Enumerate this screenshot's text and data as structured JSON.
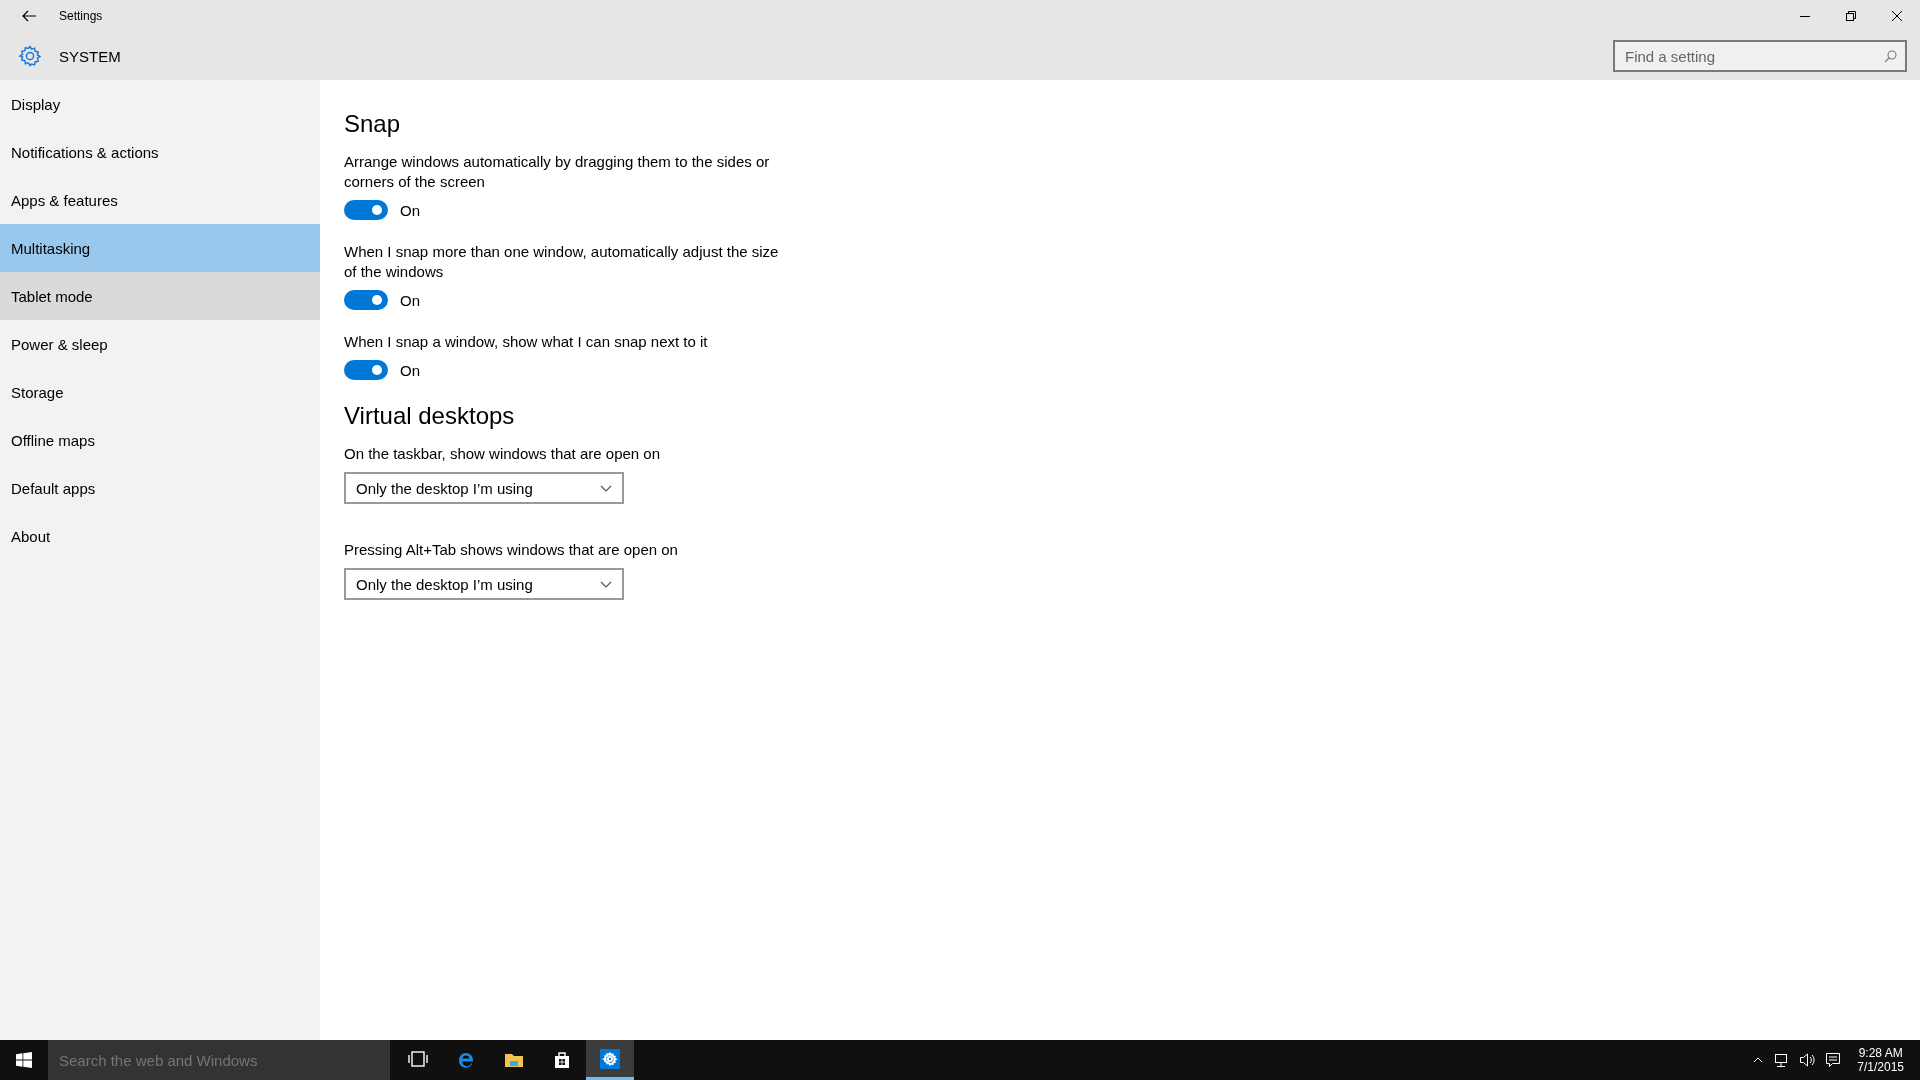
{
  "window": {
    "title": "Settings",
    "section": "SYSTEM"
  },
  "search": {
    "placeholder": "Find a setting"
  },
  "sidebar": {
    "items": [
      {
        "label": "Display",
        "selected": false,
        "hovered": false
      },
      {
        "label": "Notifications & actions",
        "selected": false,
        "hovered": false
      },
      {
        "label": "Apps & features",
        "selected": false,
        "hovered": false
      },
      {
        "label": "Multitasking",
        "selected": true,
        "hovered": false
      },
      {
        "label": "Tablet mode",
        "selected": false,
        "hovered": true
      },
      {
        "label": "Power & sleep",
        "selected": false,
        "hovered": false
      },
      {
        "label": "Storage",
        "selected": false,
        "hovered": false
      },
      {
        "label": "Offline maps",
        "selected": false,
        "hovered": false
      },
      {
        "label": "Default apps",
        "selected": false,
        "hovered": false
      },
      {
        "label": "About",
        "selected": false,
        "hovered": false
      }
    ]
  },
  "sections": [
    {
      "heading": "Snap",
      "settings": [
        {
          "kind": "toggle",
          "label": "Arrange windows automatically by dragging them to the sides or corners of the screen",
          "on": true,
          "state_text": "On"
        },
        {
          "kind": "toggle",
          "label": "When I snap more than one window, automatically adjust the size of the windows",
          "on": true,
          "state_text": "On"
        },
        {
          "kind": "toggle",
          "label": "When I snap a window, show what I can snap next to it",
          "on": true,
          "state_text": "On"
        }
      ]
    },
    {
      "heading": "Virtual desktops",
      "settings": [
        {
          "kind": "dropdown",
          "label": "On the taskbar, show windows that are open on",
          "value": "Only the desktop I’m using"
        },
        {
          "kind": "dropdown",
          "label": "Pressing Alt+Tab shows windows that are open on",
          "value": "Only the desktop I’m using"
        }
      ]
    }
  ],
  "taskbar": {
    "search_placeholder": "Search the web and Windows",
    "apps": [
      {
        "kind": "task-view",
        "active": false
      },
      {
        "kind": "browser",
        "active": false
      },
      {
        "kind": "folder",
        "active": false
      },
      {
        "kind": "store",
        "active": false
      },
      {
        "kind": "settings",
        "active": true
      }
    ],
    "time": "9:28 AM",
    "date": "7/1/2015"
  }
}
